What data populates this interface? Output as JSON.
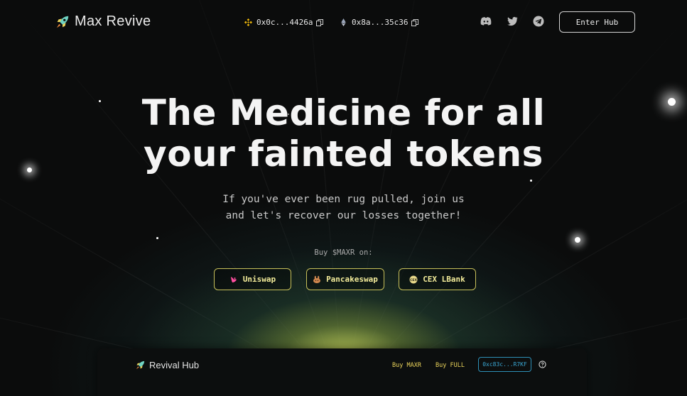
{
  "header": {
    "brand": "Max Revive",
    "icons": [
      "rocket-logo-icon",
      "copy-icon",
      "discord-icon",
      "twitter-icon",
      "telegram-icon",
      "bnb-icon",
      "ethereum-icon"
    ],
    "bsc_address": "0x0c...4426a",
    "eth_address": "0x8a...35c36",
    "enter_hub": "Enter Hub"
  },
  "hero": {
    "title_line1": "The Medicine for all",
    "title_line2": "your fainted tokens",
    "subtitle_line1": "If you've ever been rug pulled, join us",
    "subtitle_line2": "and let's recover our losses together!",
    "buy_label": "Buy $MAXR on:",
    "exchanges": [
      {
        "label": "Uniswap",
        "icon": "uniswap-icon"
      },
      {
        "label": "Pancakeswap",
        "icon": "pancakeswap-icon"
      },
      {
        "label": "CEX LBank",
        "icon": "lbank-icon"
      }
    ]
  },
  "panel": {
    "brand": "Revival Hub",
    "buy_maxr": "Buy MAXR",
    "buy_full": "Buy FULL",
    "address": "0xc83c...R7KF",
    "help_icon": "help-circle-icon"
  },
  "colors": {
    "accent_yellow": "#e9d25a",
    "button_border": "#c8c15a",
    "address_blue": "#3aa7d4",
    "background": "#0b0c0c"
  }
}
